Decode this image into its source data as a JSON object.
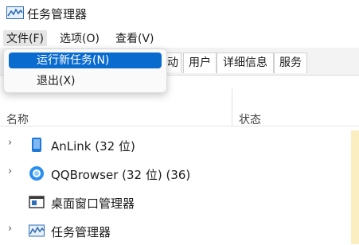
{
  "window": {
    "title": "任务管理器"
  },
  "menubar": {
    "items": [
      "文件(F)",
      "选项(O)",
      "查看(V)"
    ]
  },
  "file_menu": {
    "items": [
      "运行新任务(N)",
      "退出(X)"
    ]
  },
  "tabs": {
    "visible": [
      "动",
      "用户",
      "详细信息",
      "服务"
    ]
  },
  "columns": {
    "name": "名称",
    "status": "状态"
  },
  "processes": [
    {
      "label": "AnLink (32 位)",
      "icon": "anlink-icon",
      "expandable": true
    },
    {
      "label": "QQBrowser (32 位) (36)",
      "icon": "qqbrowser-icon",
      "expandable": true
    },
    {
      "label": "桌面窗口管理器",
      "icon": "desktop-window-manager-icon",
      "expandable": false
    },
    {
      "label": "任务管理器",
      "icon": "task-manager-icon",
      "expandable": true
    }
  ],
  "colors": {
    "accent": "#0a6bcf",
    "cpu_highlight": "#fbefc2"
  }
}
